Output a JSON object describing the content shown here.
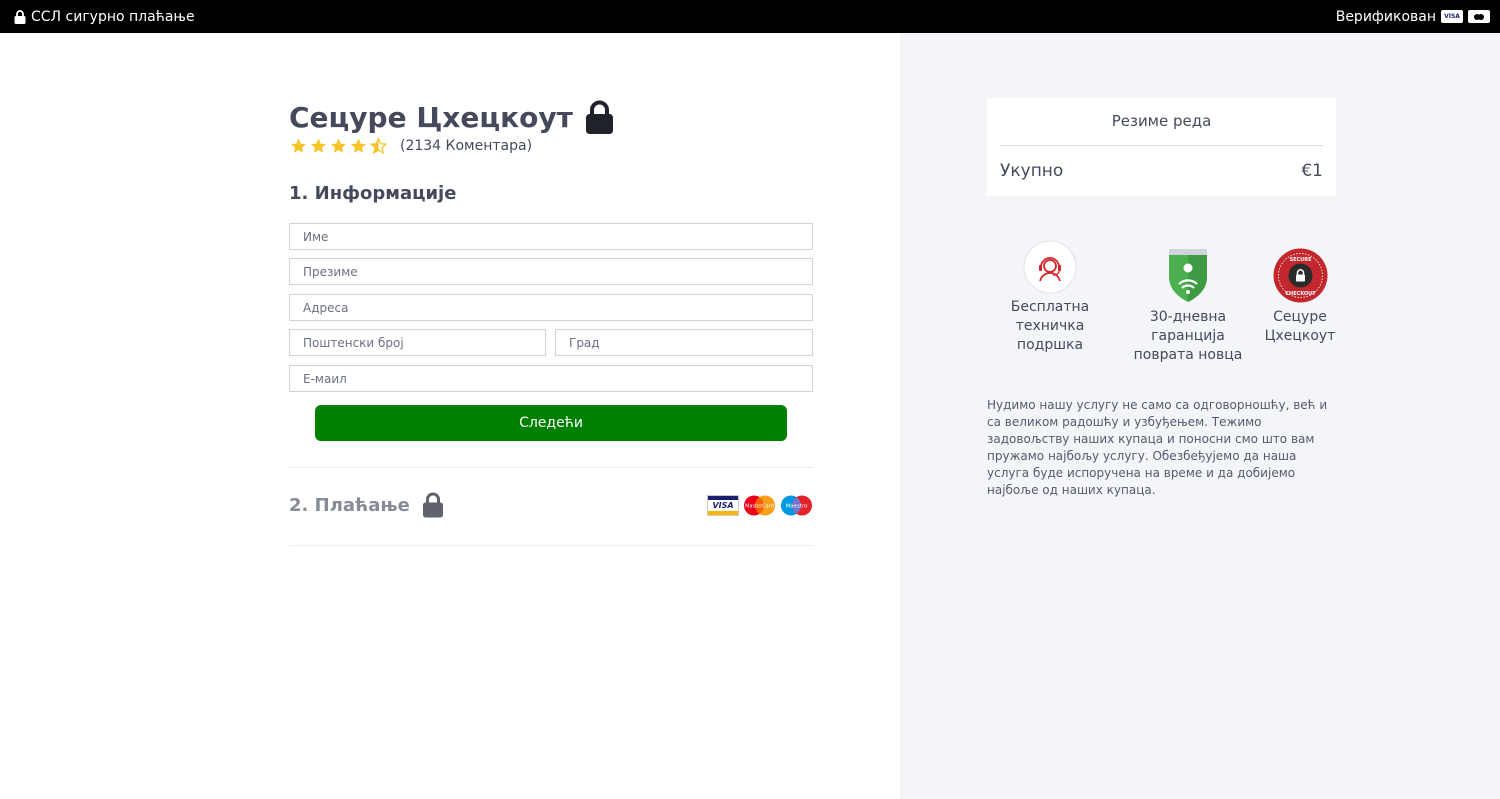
{
  "topbar": {
    "secure_label": "ССЛ сигурно плаћање",
    "verified_label": "Верификован",
    "visa_mini": "VISA"
  },
  "checkout": {
    "title": "Сецуре Цхецкоут",
    "rating": 4.5,
    "reviews_label": "(2134 Коментара)"
  },
  "section1": {
    "title": "1. Информације",
    "fields": {
      "first_name": "Име",
      "last_name": "Презиме",
      "address": "Адреса",
      "postal": "Поштенски број",
      "city": "Град",
      "email": "Е-маил"
    },
    "next_label": "Следећи"
  },
  "section2": {
    "title": "2. Плаћање",
    "visa_label": "VISA",
    "mastercard_label": "MasterCard",
    "maestro_label": "Maestro"
  },
  "summary": {
    "title": "Резиме реда",
    "total_label": "Укупно",
    "total_value": "€1"
  },
  "badges": [
    {
      "lines": [
        "Бесплатна",
        "техничка",
        "подршка"
      ],
      "icon": "support-agent-icon"
    },
    {
      "lines": [
        "30-дневна гаранција",
        "поврата новца"
      ],
      "icon": "shield-guarantee-icon"
    },
    {
      "lines": [
        "Сецуре",
        "Цхецкоут"
      ],
      "icon": "secure-checkout-seal-icon"
    }
  ],
  "seal": {
    "top_text": "SECURE",
    "bottom_text": "CHECKOUT"
  },
  "description": "Нудимо нашу услугу не само са одговорношћу, већ и са великом радошћу и узбуђењем. Тежимо задовољству наших купаца и поносни смо што вам пружамо најбољу услугу. Обезбеђујемо да наша услуга буде испоручена на време и да добијемо најбоље од наших купаца.",
  "colors": {
    "accent_green": "#008000",
    "star": "#f7c325",
    "right_panel": "#f4f5f9",
    "text": "#444a5c"
  }
}
